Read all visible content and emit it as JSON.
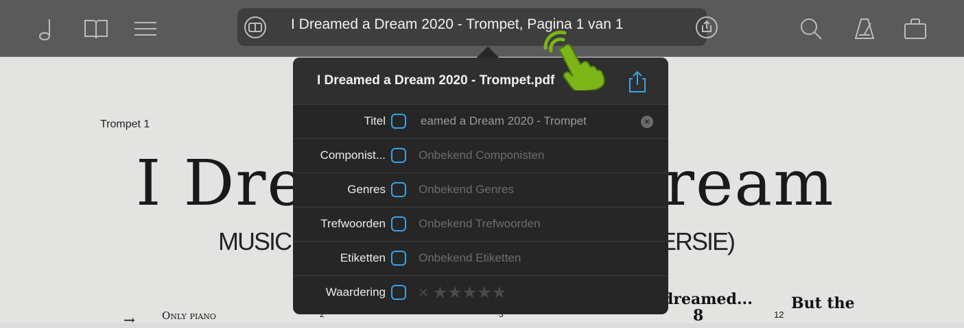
{
  "toolbar": {
    "title": "I Dreamed a Dream 2020 - Trompet, Pagina 1 van 1",
    "icons": [
      "note-icon",
      "book-icon",
      "menu-icon",
      "view-icon",
      "share-icon",
      "search-icon",
      "metronome-icon",
      "bag-icon"
    ]
  },
  "sheet": {
    "part": "Trompet 1",
    "title": "I Dream",
    "title_end": "ream",
    "subtitle_left": "MUSIC",
    "subtitle_right": "ERSIE)",
    "only_piano": "Only piano",
    "dreamed": "dreamed...",
    "but_the": "But the",
    "bar_2": "2",
    "bar_3": "3",
    "bar_12": "12",
    "note_8": "8"
  },
  "popover": {
    "title": "I Dreamed a Dream 2020 - Trompet.pdf",
    "rows": [
      {
        "label": "Titel",
        "value": "eamed a Dream 2020 - Trompet"
      },
      {
        "label": "Componist...",
        "value": "Onbekend Componisten"
      },
      {
        "label": "Genres",
        "value": "Onbekend Genres"
      },
      {
        "label": "Trefwoorden",
        "value": "Onbekend Trefwoorden"
      },
      {
        "label": "Etiketten",
        "value": "Onbekend Etiketten"
      },
      {
        "label": "Waardering",
        "value": "× ★★★★★"
      }
    ]
  },
  "colors": {
    "accent": "#3aa2e6",
    "toolbar": "#5a5a5a",
    "popover": "#262626",
    "hand": "#7cb518"
  }
}
